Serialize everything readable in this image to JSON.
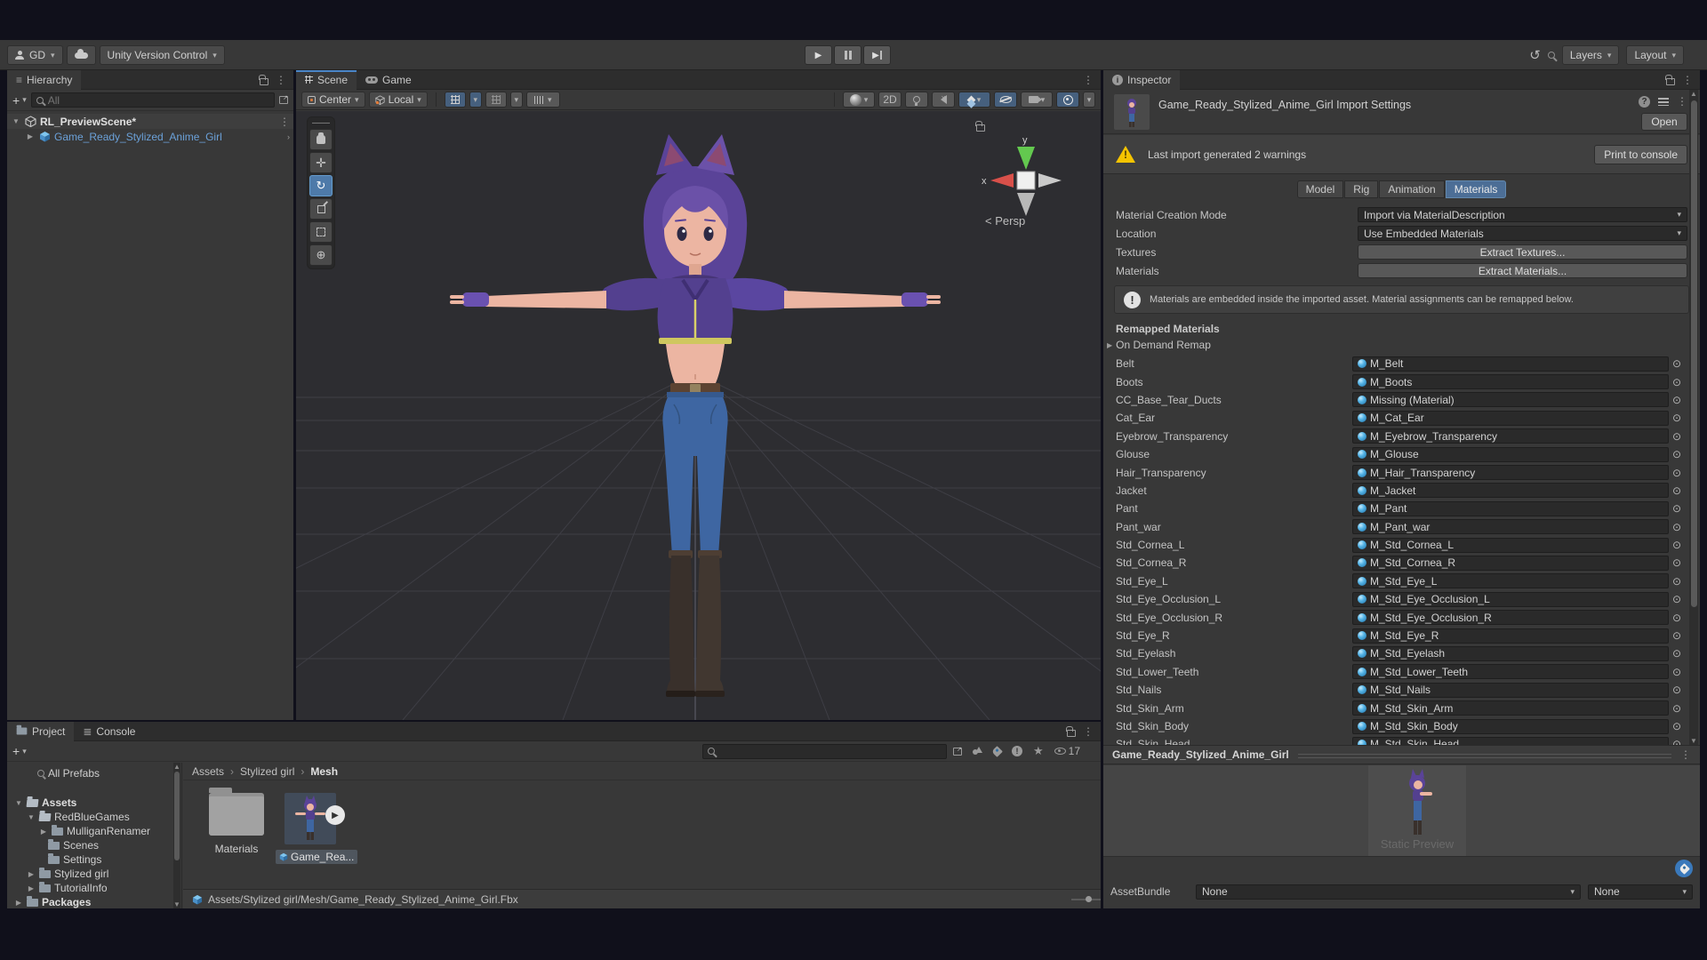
{
  "topbar": {
    "account": "GD",
    "version_control": "Unity Version Control",
    "layers": "Layers",
    "layout": "Layout"
  },
  "hierarchy": {
    "tab": "Hierarchy",
    "search_placeholder": "All",
    "scene_row": "RL_PreviewScene*",
    "prefab_row": "Game_Ready_Stylized_Anime_Girl"
  },
  "scene": {
    "tab_scene": "Scene",
    "tab_game": "Game",
    "pivot": "Center",
    "orientation": "Local",
    "mode_2d": "2D",
    "persp_label": "Persp",
    "persp_chevron": "<",
    "axis_y": "y",
    "axis_x": "x"
  },
  "inspector": {
    "tab": "Inspector",
    "title": "Game_Ready_Stylized_Anime_Girl Import Settings",
    "open": "Open",
    "warning": "Last import generated 2 warnings",
    "print_to_console": "Print to console",
    "tabs": [
      {
        "label": "Model"
      },
      {
        "label": "Rig"
      },
      {
        "label": "Animation"
      },
      {
        "label": "Materials",
        "cls": "active"
      }
    ],
    "material_creation_mode_label": "Material Creation Mode",
    "material_creation_mode_value": "Import via MaterialDescription",
    "location_label": "Location",
    "location_value": "Use Embedded Materials",
    "textures_label": "Textures",
    "textures_button": "Extract Textures...",
    "materials_label": "Materials",
    "materials_button": "Extract Materials...",
    "info": "Materials are embedded inside the imported asset. Material assignments can be remapped below.",
    "remapped_header": "Remapped Materials",
    "on_demand_remap": "On Demand Remap",
    "remapped": [
      {
        "label": "Belt",
        "value": "M_Belt"
      },
      {
        "label": "Boots",
        "value": "M_Boots"
      },
      {
        "label": "CC_Base_Tear_Ducts",
        "value": "Missing (Material)"
      },
      {
        "label": "Cat_Ear",
        "value": "M_Cat_Ear"
      },
      {
        "label": "Eyebrow_Transparency",
        "value": "M_Eyebrow_Transparency"
      },
      {
        "label": "Glouse",
        "value": "M_Glouse"
      },
      {
        "label": "Hair_Transparency",
        "value": "M_Hair_Transparency"
      },
      {
        "label": "Jacket",
        "value": "M_Jacket"
      },
      {
        "label": "Pant",
        "value": "M_Pant"
      },
      {
        "label": "Pant_war",
        "value": "M_Pant_war"
      },
      {
        "label": "Std_Cornea_L",
        "value": "M_Std_Cornea_L"
      },
      {
        "label": "Std_Cornea_R",
        "value": "M_Std_Cornea_R"
      },
      {
        "label": "Std_Eye_L",
        "value": "M_Std_Eye_L"
      },
      {
        "label": "Std_Eye_Occlusion_L",
        "value": "M_Std_Eye_Occlusion_L"
      },
      {
        "label": "Std_Eye_Occlusion_R",
        "value": "M_Std_Eye_Occlusion_R"
      },
      {
        "label": "Std_Eye_R",
        "value": "M_Std_Eye_R"
      },
      {
        "label": "Std_Eyelash",
        "value": "M_Std_Eyelash"
      },
      {
        "label": "Std_Lower_Teeth",
        "value": "M_Std_Lower_Teeth"
      },
      {
        "label": "Std_Nails",
        "value": "M_Std_Nails"
      },
      {
        "label": "Std_Skin_Arm",
        "value": "M_Std_Skin_Arm"
      },
      {
        "label": "Std_Skin_Body",
        "value": "M_Std_Skin_Body"
      },
      {
        "label": "Std_Skin_Head",
        "value": "M_Std_Skin_Head"
      }
    ],
    "preview_title": "Game_Ready_Stylized_Anime_Girl",
    "static_preview": "Static Preview",
    "assetbundle_label": "AssetBundle",
    "assetbundle_value": "None",
    "assetbundle_variant": "None"
  },
  "project": {
    "tab_project": "Project",
    "tab_console": "Console",
    "tree": [
      {
        "label": "All Prefabs",
        "arrow": "",
        "icon": "i-srch",
        "cls": "fav",
        "indent": 20
      },
      {
        "label": "Assets",
        "arrow": "▼",
        "icon": "i-folder-open",
        "cls": "bold",
        "indent": 8
      },
      {
        "label": "RedBlueGames",
        "arrow": "▼",
        "icon": "i-folder-open",
        "indent": 22
      },
      {
        "label": "MulliganRenamer",
        "arrow": "▶",
        "icon": "i-folder",
        "indent": 36
      },
      {
        "label": "Scenes",
        "arrow": "",
        "icon": "i-folder",
        "indent": 32
      },
      {
        "label": "Settings",
        "arrow": "",
        "icon": "i-folder",
        "indent": 32
      },
      {
        "label": "Stylized girl",
        "arrow": "▶",
        "icon": "i-folder",
        "indent": 22
      },
      {
        "label": "TutorialInfo",
        "arrow": "▶",
        "icon": "i-folder",
        "indent": 22
      },
      {
        "label": "Packages",
        "arrow": "▶",
        "icon": "i-folder",
        "cls": "bold",
        "indent": 8
      }
    ],
    "breadcrumb": [
      {
        "label": "Assets"
      },
      {
        "label": "Stylized girl"
      },
      {
        "label": "Mesh",
        "cls": "last"
      }
    ],
    "items": [
      {
        "label": "Materials"
      },
      {
        "label": "Game_Rea..."
      }
    ],
    "status_path": "Assets/Stylized girl/Mesh/Game_Ready_Stylized_Anime_Girl.Fbx",
    "hidden_count": "17"
  },
  "colors": {
    "accent_tab_blue": "#4c6e96",
    "scene_tab_underline": "#4a86c8",
    "link_blue": "#6ba1d9",
    "warning_yellow": "#f5c400",
    "hair_purple": "#5a4398",
    "jacket_purple": "#53408f",
    "jeans_blue": "#3e66a2",
    "outer_background": "#10101b"
  }
}
